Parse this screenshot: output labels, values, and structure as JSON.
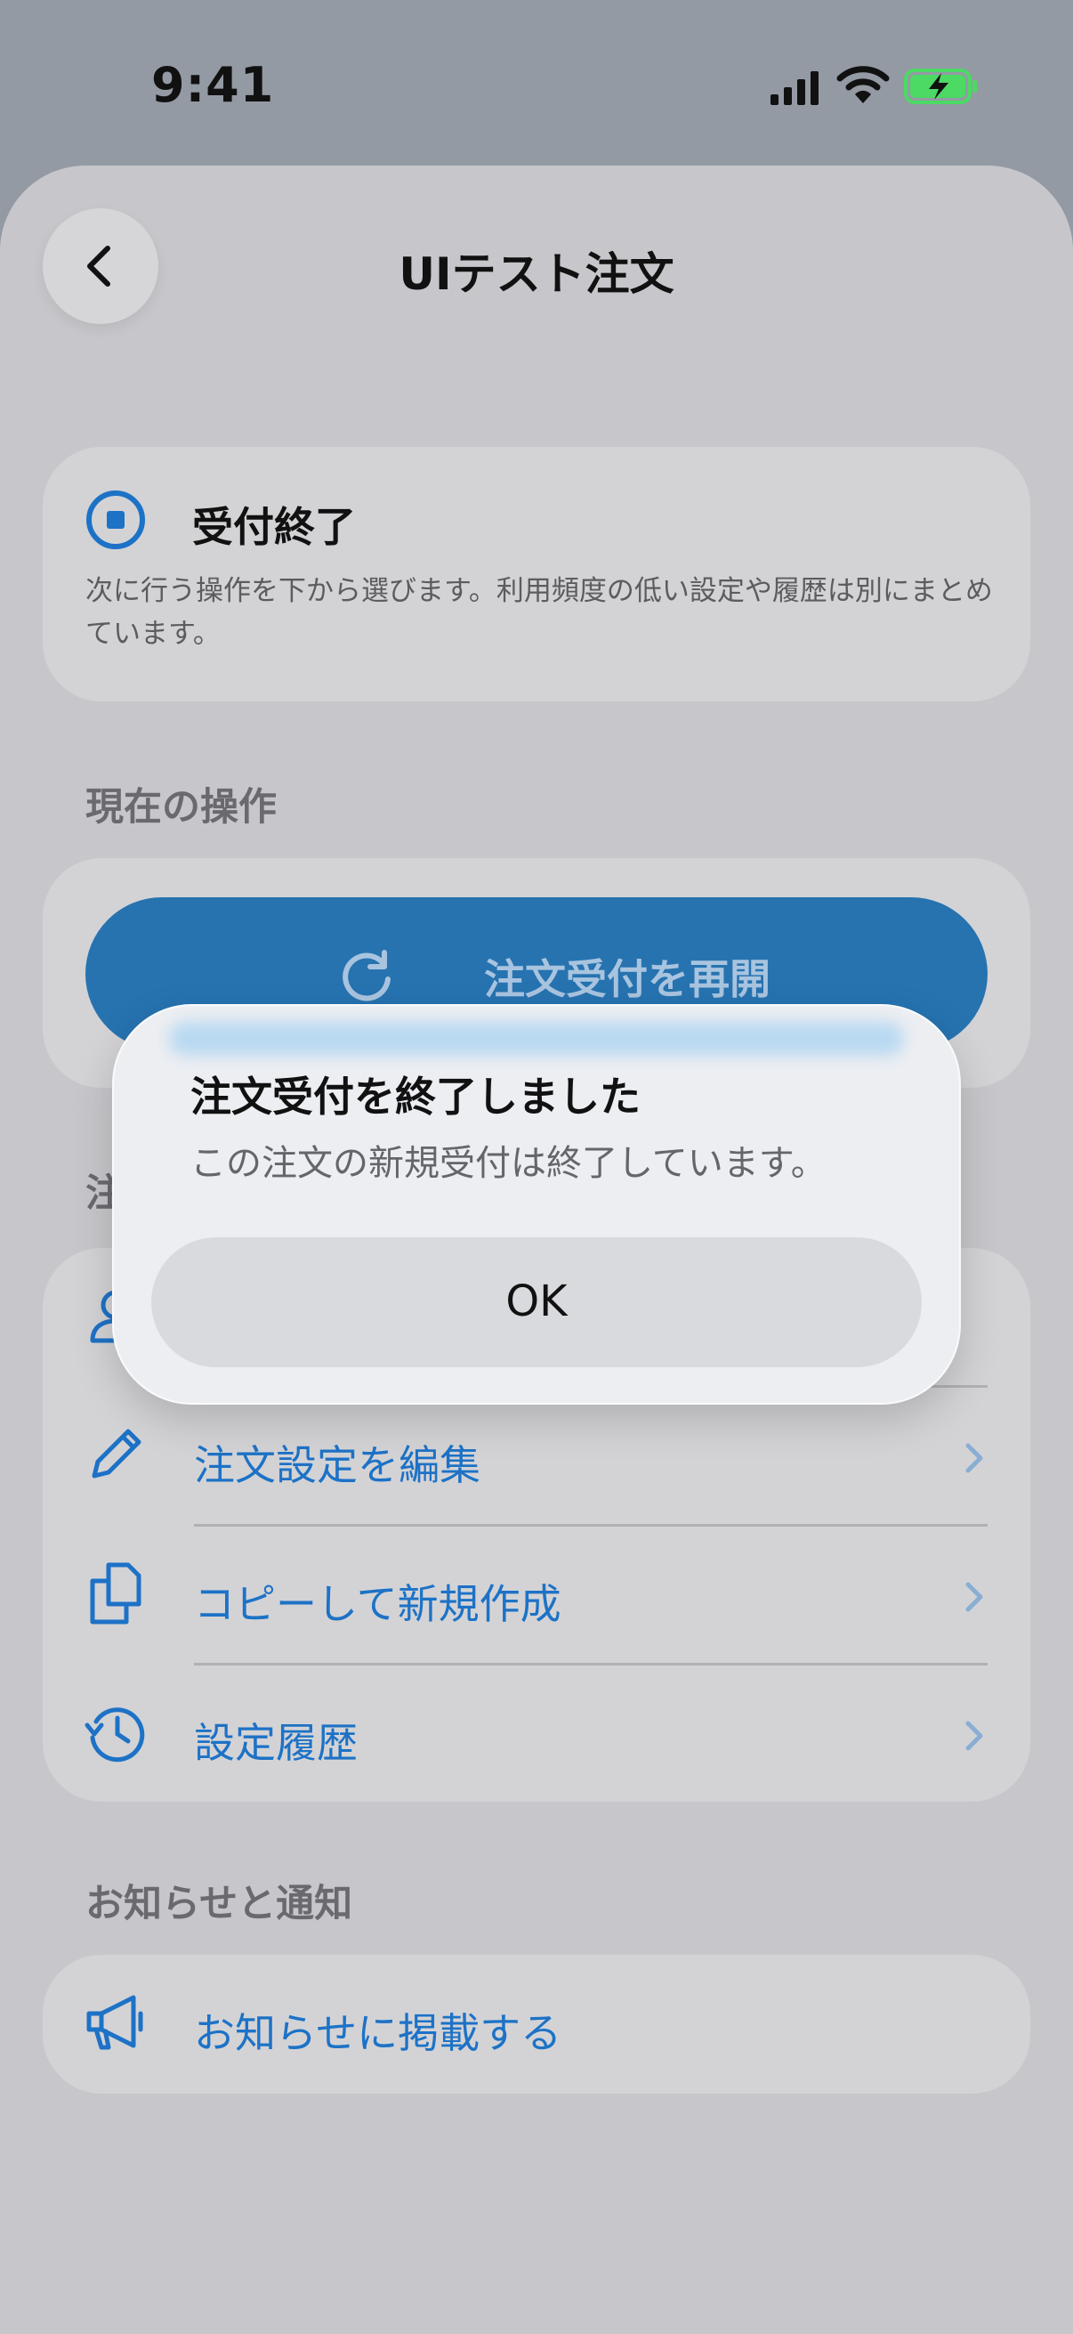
{
  "status_bar": {
    "time": "9:41"
  },
  "header": {
    "title": "UIテスト注文"
  },
  "status_card": {
    "title": "受付終了",
    "description": "次に行う操作を下から選びます。利用頻度の低い設定や履歴は別にまとめています。"
  },
  "sections": {
    "current": "現在の操作",
    "order": "注文",
    "notice": "お知らせと通知"
  },
  "primary_action": {
    "label": "注文受付を再開"
  },
  "order_items": [
    {
      "label": ""
    },
    {
      "label": "注文設定を編集"
    },
    {
      "label": "コピーして新規作成"
    },
    {
      "label": "設定履歴"
    }
  ],
  "notice_item": {
    "label": "お知らせに掲載する"
  },
  "alert": {
    "title": "注文受付を終了しました",
    "message": "この注文の新規受付は終了しています。",
    "ok_label": "OK"
  },
  "colors": {
    "accent": "#1d72c6",
    "primary_button": "#2673b0",
    "battery_fill": "#4cd964"
  }
}
